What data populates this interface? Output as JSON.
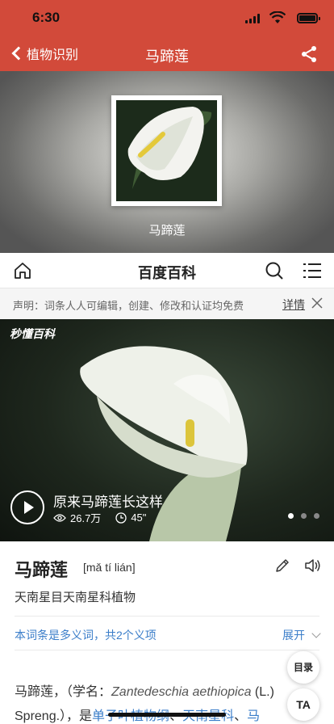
{
  "status_bar": {
    "time": "6:30"
  },
  "navbar": {
    "back_label": "植物识别",
    "title": "马蹄莲"
  },
  "hero": {
    "caption": "马蹄莲"
  },
  "baike_header": {
    "title": "百度百科"
  },
  "notice": {
    "text": "声明：词条人人可编辑，创建、修改和认证均免费",
    "detail_label": "详情"
  },
  "video": {
    "brand": "秒懂百科",
    "title": "原来马蹄莲长这样",
    "views": "26.7万",
    "duration": "45\"",
    "slide_count": 3,
    "active_slide": 1
  },
  "entry": {
    "name": "马蹄莲",
    "pinyin": "[mǎ tí lián]",
    "description": "天南星目天南星科植物",
    "polysemy": "本词条是多义词，共2个义项",
    "expand_label": "展开",
    "body_prefix": "马蹄莲，（学名：",
    "body_latin": "Zantedeschia aethiopica",
    "body_mid": " (L.) Spreng.），是",
    "body_link1": "单子叶植物纲",
    "body_sep": "、",
    "body_link2": "天南星科",
    "body_link3": "马"
  },
  "float_buttons": {
    "toc": "目录",
    "font": "TA"
  }
}
